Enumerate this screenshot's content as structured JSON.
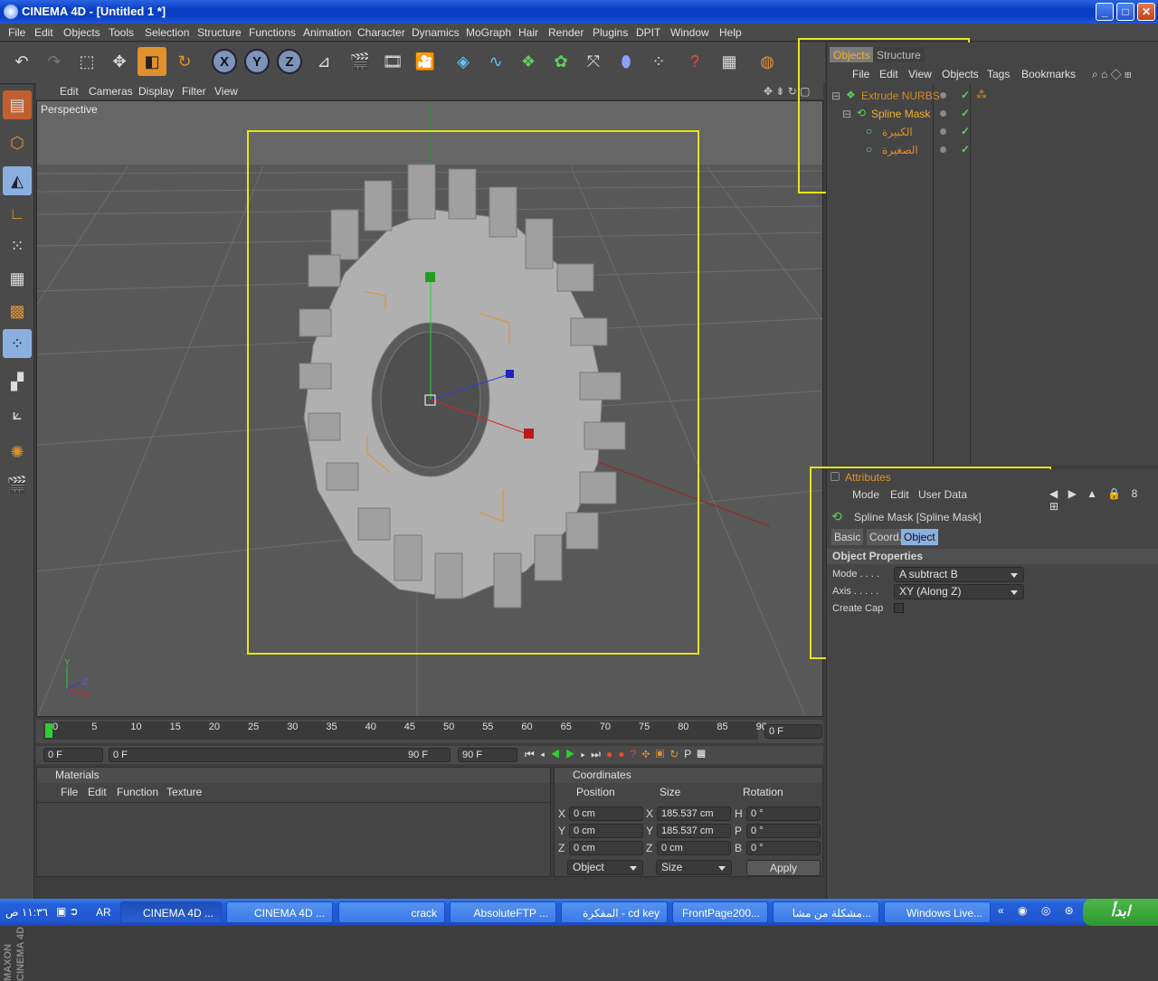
{
  "window": {
    "title": "CINEMA 4D - [Untitled 1 *]",
    "minimize": "_",
    "maximize": "□",
    "close": "✕"
  },
  "menubar": [
    "File",
    "Edit",
    "Objects",
    "Tools",
    "Selection",
    "Structure",
    "Functions",
    "Animation",
    "Character",
    "Dynamics",
    "MoGraph",
    "Hair",
    "Render",
    "Plugins",
    "DPIT",
    "Window",
    "Help"
  ],
  "toolbar": {
    "x_label": "X",
    "y_label": "Y",
    "z_label": "Z"
  },
  "viewport": {
    "menu": [
      "Edit",
      "Cameras",
      "Display",
      "Filter",
      "View"
    ],
    "label": "Perspective"
  },
  "timeline": {
    "ticks": [
      "0",
      "5",
      "10",
      "15",
      "20",
      "25",
      "30",
      "35",
      "40",
      "45",
      "50",
      "55",
      "60",
      "65",
      "70",
      "75",
      "80",
      "85",
      "90"
    ],
    "current_frame": "0 F",
    "start_field": "0 F",
    "range_start": "0 F",
    "range_end": "90 F",
    "end_field": "90 F"
  },
  "materials": {
    "title": "Materials",
    "menu": [
      "File",
      "Edit",
      "Function",
      "Texture"
    ]
  },
  "coordinates": {
    "title": "Coordinates",
    "headers": [
      "Position",
      "Size",
      "Rotation"
    ],
    "rows": [
      {
        "axis": "X",
        "pos": "0 cm",
        "size_axis": "X",
        "size": "185.537 cm",
        "rot_axis": "H",
        "rot": "0 °"
      },
      {
        "axis": "Y",
        "pos": "0 cm",
        "size_axis": "Y",
        "size": "185.537 cm",
        "rot_axis": "P",
        "rot": "0 °"
      },
      {
        "axis": "Z",
        "pos": "0 cm",
        "size_axis": "Z",
        "size": "0 cm",
        "rot_axis": "B",
        "rot": "0 °"
      }
    ],
    "mode_select": "Object",
    "size_select": "Size",
    "apply": "Apply"
  },
  "object_manager": {
    "tabs": [
      "Objects",
      "Structure"
    ],
    "menu": [
      "File",
      "Edit",
      "View",
      "Objects",
      "Tags",
      "Bookmarks"
    ],
    "items": [
      {
        "name": "Extrude NURBS",
        "color": "#d48a2a"
      },
      {
        "name": "Spline Mask",
        "color": "#f0b030"
      },
      {
        "name": "الكبيرة",
        "color": "#e09020"
      },
      {
        "name": "الصغيرة",
        "color": "#e09020"
      }
    ]
  },
  "attributes": {
    "title": "Attributes",
    "menu": [
      "Mode",
      "Edit",
      "User Data"
    ],
    "object_title": "Spline Mask [Spline Mask]",
    "tabs": [
      "Basic",
      "Coord.",
      "Object"
    ],
    "section": "Object Properties",
    "mode_label": "Mode . . . .",
    "mode_value": "A subtract B",
    "axis_label": "Axis . . . . .",
    "axis_value": "XY (Along Z)",
    "cap_label": "Create Cap"
  },
  "taskbar": {
    "time": "١١:٣٦ ص",
    "lang": "AR",
    "tasks": [
      "CINEMA 4D ...",
      "CINEMA 4D ...",
      "crack",
      "AbsoluteFTP ...",
      "المفكرة - cd key",
      "FrontPage200...",
      "مشكلة من مشا...",
      "Windows Live..."
    ],
    "start": "ابدأ"
  },
  "colors": {
    "accent_orange": "#e0912d",
    "highlight_yellow": "#e4e41e",
    "taskbar_blue": "#245fd9"
  }
}
